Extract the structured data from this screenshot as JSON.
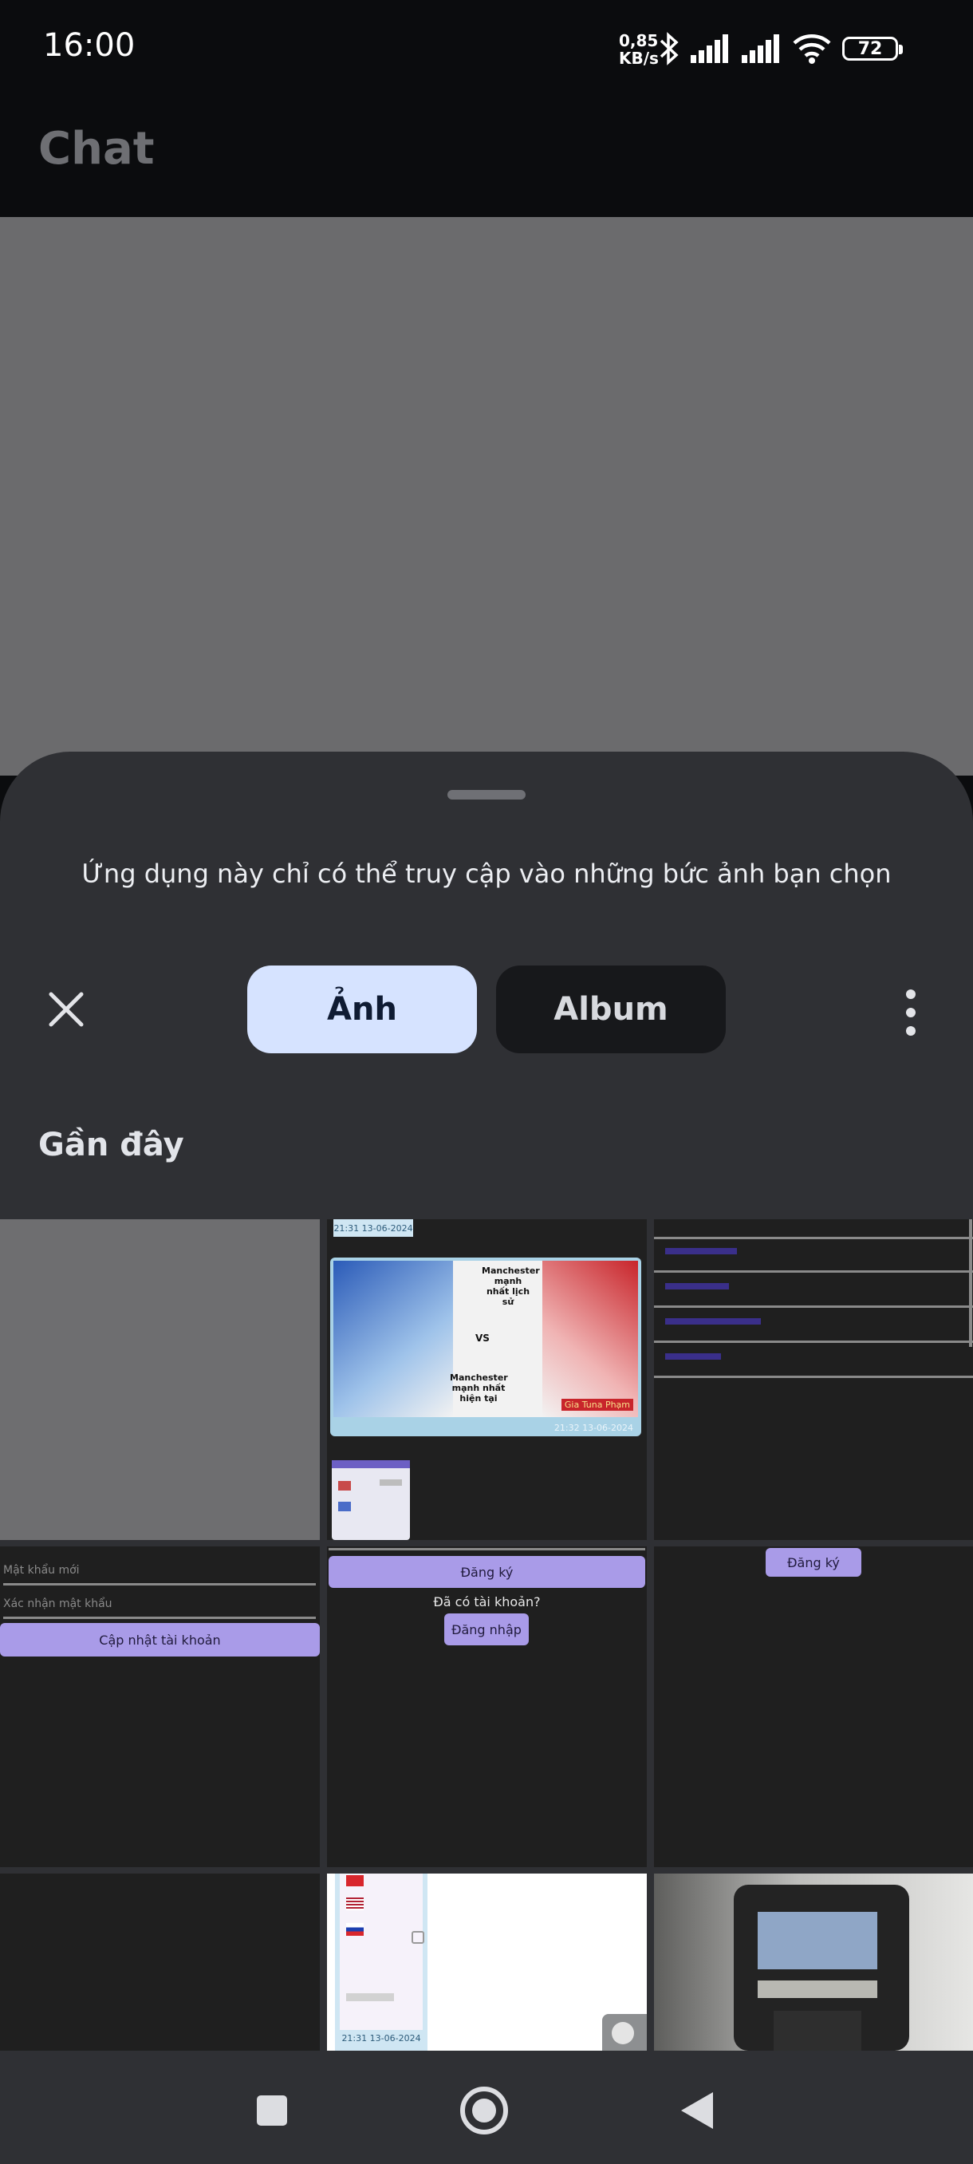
{
  "status_bar": {
    "time": "16:00",
    "speed_value": "0,85",
    "speed_unit": "KB/s",
    "battery": "72",
    "icons": [
      "bluetooth-icon",
      "signal-icon",
      "signal-icon",
      "wifi-icon",
      "battery-icon"
    ]
  },
  "app_bar": {
    "title": "Chat"
  },
  "picker": {
    "notice": "Ứng dụng này chỉ có thể truy cập vào những bức ảnh bạn chọn",
    "tabs": [
      {
        "label": "Ảnh",
        "selected": true
      },
      {
        "label": "Album",
        "selected": false
      }
    ],
    "section_title": "Gần đây"
  },
  "thumbnails": {
    "t2_time_top": "21:31 13-06-2024",
    "t2_left_text": "Manchester mạnh nhất lịch sử",
    "t2_vs": "VS",
    "t2_right_text": "Manchester mạnh nhất hiện tại",
    "t2_tag": "Gia Tuna Phạm",
    "t2_time": "21:32 13-06-2024",
    "t4_field1": "Mật khẩu mới",
    "t4_field2": "Xác nhận mật khẩu",
    "t4_button": "Cập nhật tài khoản",
    "t5_button1": "Đăng ký",
    "t5_text": "Đã có tài khoản?",
    "t5_button2": "Đăng nhập",
    "t6_button": "Đăng ký",
    "t8_time": "21:31 13-06-2024"
  },
  "colors": {
    "background": "#0b0c0e",
    "sheet": "#2f3034",
    "tab_selected": "#d6e3ff",
    "tab_unselected": "#17181b",
    "accent_button": "#a99be8"
  }
}
